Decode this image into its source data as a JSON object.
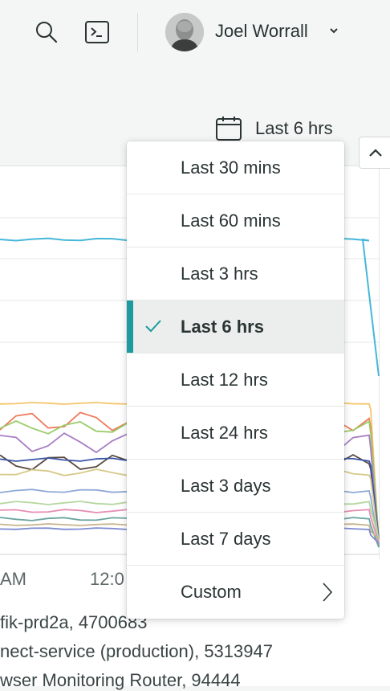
{
  "header": {
    "user_name": "Joel Worrall",
    "icons": [
      "search-icon",
      "terminal-icon",
      "chevron-down-icon"
    ]
  },
  "time_picker": {
    "label": "Last 6 hrs",
    "icon": "calendar-icon",
    "options": [
      {
        "label": "Last 30 mins",
        "selected": false
      },
      {
        "label": "Last 60 mins",
        "selected": false
      },
      {
        "label": "Last 3 hrs",
        "selected": false
      },
      {
        "label": "Last 6 hrs",
        "selected": true
      },
      {
        "label": "Last 12 hrs",
        "selected": false
      },
      {
        "label": "Last 24 hrs",
        "selected": false
      },
      {
        "label": "Last 3 days",
        "selected": false
      },
      {
        "label": "Last 7 days",
        "selected": false
      },
      {
        "label": "Custom",
        "selected": false,
        "has_submenu": true
      }
    ]
  },
  "chart": {
    "x_tick_labels": [
      "AM",
      "12:0"
    ],
    "legend": [
      "fik-prd2a, 4700683",
      "nect-service (production), 5313947",
      "wser Monitoring Router, 94444"
    ],
    "series_colors": [
      "#45b7d8",
      "#f5c56b",
      "#ee7b5d",
      "#9bcc6a",
      "#a77fc4",
      "#5a4a3f",
      "#3a55a6",
      "#d6c98a",
      "#8fa9d6",
      "#b5d7a0",
      "#e58fb5",
      "#6aa5a0",
      "#c9b38d",
      "#7e8bd0"
    ]
  },
  "colors": {
    "accent": "#1b9aa0",
    "selected_bg": "#eceeed"
  }
}
